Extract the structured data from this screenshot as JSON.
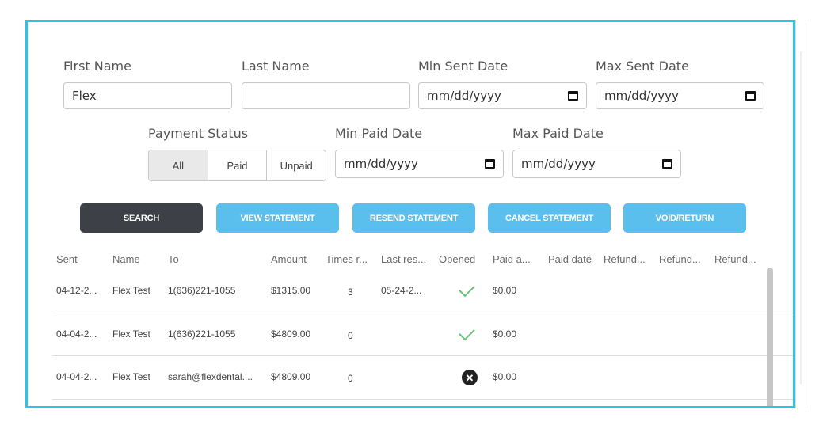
{
  "filters": {
    "first_name_label": "First Name",
    "first_name_value": "Flex",
    "last_name_label": "Last Name",
    "last_name_value": "",
    "min_sent_label": "Min Sent Date",
    "max_sent_label": "Max Sent Date",
    "payment_status_label": "Payment Status",
    "min_paid_label": "Min Paid Date",
    "max_paid_label": "Max Paid Date",
    "date_placeholder": "mm/dd/yyyy",
    "payment_options": [
      "All",
      "Paid",
      "Unpaid"
    ],
    "payment_selected": "All"
  },
  "actions": {
    "search": "SEARCH",
    "view_statement": "VIEW STATEMENT",
    "resend_statement": "RESEND STATEMENT",
    "cancel_statement": "CANCEL STATEMENT",
    "void_return": "VOID/RETURN"
  },
  "table": {
    "headers": [
      "Sent",
      "Name",
      "To",
      "Amount",
      "Times r...",
      "Last res...",
      "Opened",
      "Paid a...",
      "Paid date",
      "Refund...",
      "Refund...",
      "Refund..."
    ],
    "rows": [
      {
        "sent": "04-12-2...",
        "name": "Flex Test",
        "to": "1(636)221-1055",
        "amount": "$1315.00",
        "times": "3",
        "last": "05-24-2...",
        "opened": "check-icon",
        "paid_amount": "$0.00"
      },
      {
        "sent": "04-04-2...",
        "name": "Flex Test",
        "to": "1(636)221-1055",
        "amount": "$4809.00",
        "times": "0",
        "last": "",
        "opened": "check-icon",
        "paid_amount": "$0.00"
      },
      {
        "sent": "04-04-2...",
        "name": "Flex Test",
        "to": "sarah@flexdental....",
        "amount": "$4809.00",
        "times": "0",
        "last": "",
        "opened": "x-circle-icon",
        "paid_amount": "$0.00"
      }
    ]
  },
  "colors": {
    "frame_border": "#29c6ea",
    "primary_button": "#3d4147",
    "secondary_button": "#5bbfee",
    "check_green": "#6dc07a"
  }
}
